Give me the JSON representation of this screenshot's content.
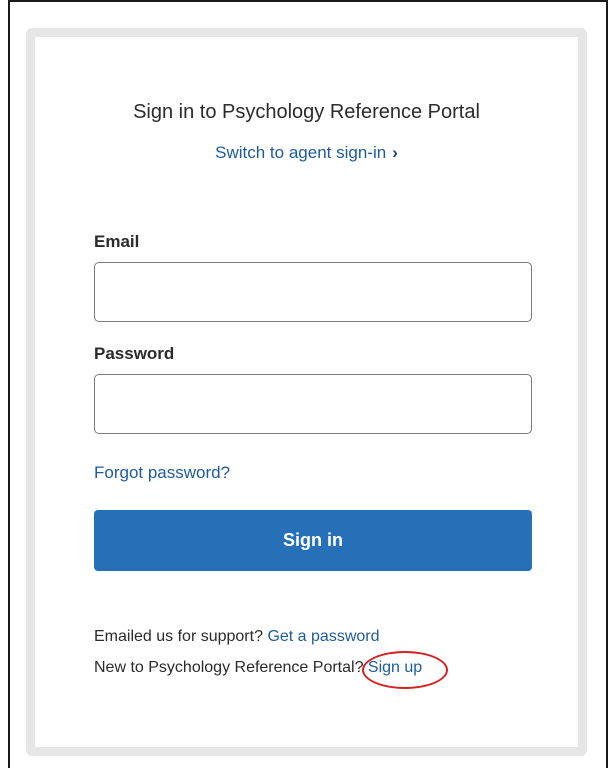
{
  "page": {
    "title": "Sign in to Psychology Reference Portal",
    "switch_link": "Switch to agent sign-in",
    "switch_chevron": "›"
  },
  "form": {
    "email_label": "Email",
    "email_value": "",
    "password_label": "Password",
    "password_value": "",
    "forgot_link": "Forgot password?",
    "signin_button": "Sign in"
  },
  "footer": {
    "support_text": "Emailed us for support?",
    "support_link": "Get a password",
    "new_text": "New to Psychology Reference Portal?",
    "signup_link": "Sign up"
  },
  "annotation": {
    "highlight_color": "#d42020"
  },
  "colors": {
    "accent": "#2670b8",
    "link": "#1d5b9c"
  }
}
